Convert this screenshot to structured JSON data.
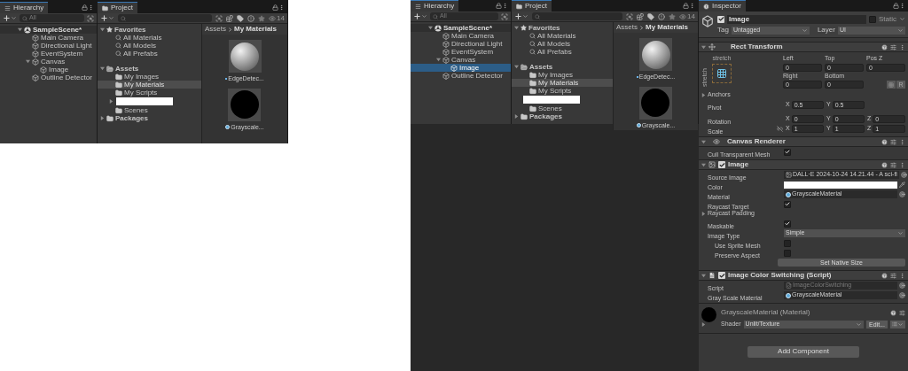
{
  "left_screenshot": {
    "hierarchy": {
      "tab": "Hierarchy",
      "search_placeholder": "All",
      "tree": [
        {
          "label": "SampleScene*",
          "kind": "scene",
          "selected": false,
          "expanded": true,
          "children": [
            {
              "label": "Main Camera",
              "kind": "object",
              "selected": false
            },
            {
              "label": "Directional Light",
              "kind": "object",
              "selected": false
            },
            {
              "label": "EventSystem",
              "kind": "object",
              "selected": false
            },
            {
              "label": "Canvas",
              "kind": "object",
              "selected": false,
              "expanded": true,
              "children": [
                {
                  "label": "Image",
                  "kind": "object",
                  "selected": false
                }
              ]
            },
            {
              "label": "Outline Detector",
              "kind": "object",
              "selected": false
            }
          ]
        }
      ]
    },
    "project": {
      "tab": "Project",
      "count": "14",
      "tree": [
        {
          "label": "Favorites",
          "kind": "favorites",
          "selected": false,
          "expanded": true,
          "children": [
            {
              "label": "All Materials",
              "kind": "search",
              "selected": false
            },
            {
              "label": "All Models",
              "kind": "search",
              "selected": false
            },
            {
              "label": "All Prefabs",
              "kind": "search",
              "selected": false
            }
          ]
        },
        {
          "label": "Assets",
          "kind": "folder",
          "selected": false,
          "expanded": true,
          "children": [
            {
              "label": "My Images",
              "kind": "folder",
              "selected": false
            },
            {
              "label": "My Materials",
              "kind": "folder",
              "selected": true
            },
            {
              "label": "My Scripts",
              "kind": "folder",
              "selected": false
            },
            {
              "kind": "redacted",
              "expanded": false
            },
            {
              "label": "Scenes",
              "kind": "folder",
              "selected": false
            }
          ]
        },
        {
          "label": "Packages",
          "kind": "folder",
          "selected": false,
          "expanded": false
        }
      ],
      "breadcrumb": [
        "Assets",
        "My Materials"
      ],
      "assets": [
        {
          "label": "EdgeDetec...",
          "kind": "sphere"
        },
        {
          "label": "Grayscale...",
          "kind": "black"
        }
      ]
    }
  },
  "right_window": {
    "hierarchy": {
      "tab": "Hierarchy",
      "search_placeholder": "All",
      "tree": [
        {
          "label": "SampleScene*",
          "kind": "scene",
          "selected": false,
          "expanded": true,
          "children": [
            {
              "label": "Main Camera",
              "kind": "object",
              "selected": false
            },
            {
              "label": "Directional Light",
              "kind": "object",
              "selected": false
            },
            {
              "label": "EventSystem",
              "kind": "object",
              "selected": false
            },
            {
              "label": "Canvas",
              "kind": "object",
              "selected": false,
              "expanded": true,
              "children": [
                {
                  "label": "Image",
                  "kind": "object",
                  "selected": true
                }
              ]
            },
            {
              "label": "Outline Detector",
              "kind": "object",
              "selected": false
            }
          ]
        }
      ]
    },
    "project": {
      "tab": "Project",
      "count": "14",
      "tree": [
        {
          "label": "Favorites",
          "kind": "favorites",
          "selected": false,
          "expanded": true,
          "children": [
            {
              "label": "All Materials",
              "kind": "search",
              "selected": false
            },
            {
              "label": "All Models",
              "kind": "search",
              "selected": false
            },
            {
              "label": "All Prefabs",
              "kind": "search",
              "selected": false
            }
          ]
        },
        {
          "label": "Assets",
          "kind": "folder",
          "selected": false,
          "expanded": true,
          "children": [
            {
              "label": "My Images",
              "kind": "folder",
              "selected": false
            },
            {
              "label": "My Materials",
              "kind": "folder",
              "selected": true
            },
            {
              "label": "My Scripts",
              "kind": "folder",
              "selected": false
            },
            {
              "kind": "redacted"
            },
            {
              "label": "Scenes",
              "kind": "folder",
              "selected": false
            }
          ]
        },
        {
          "label": "Packages",
          "kind": "folder",
          "selected": false,
          "expanded": false
        }
      ],
      "breadcrumb": [
        "Assets",
        "My Materials"
      ],
      "assets": [
        {
          "label": "EdgeDetec...",
          "kind": "sphere"
        },
        {
          "label": "Grayscale...",
          "kind": "black"
        }
      ]
    },
    "inspector": {
      "tab": "Inspector",
      "active": true,
      "name": "Image",
      "static_label": "Static",
      "static": false,
      "tag_label": "Tag",
      "tag": "Untagged",
      "layer_label": "Layer",
      "layer": "UI",
      "rect_transform": {
        "title": "Rect Transform",
        "expanded": true,
        "anchor_labels": [
          "stretch",
          "stretch"
        ],
        "offsets": [
          {
            "label": "Left",
            "value": "0"
          },
          {
            "label": "Top",
            "value": "0"
          },
          {
            "label": "Pos Z",
            "value": "0"
          },
          {
            "label": "Right",
            "value": "0"
          },
          {
            "label": "Bottom",
            "value": "0"
          }
        ],
        "raw_button": "R",
        "anchors": {
          "label": "Anchors",
          "expanded": false
        },
        "vectors": [
          {
            "label": "Pivot",
            "kind": "pivot",
            "axes": [
              {
                "axis": "X",
                "value": "0.5"
              },
              {
                "axis": "Y",
                "value": "0.5"
              }
            ]
          },
          {
            "label": "Rotation",
            "kind": "plain",
            "axes": [
              {
                "axis": "X",
                "value": "0"
              },
              {
                "axis": "Y",
                "value": "0"
              },
              {
                "axis": "Z",
                "value": "0"
              }
            ]
          },
          {
            "label": "Scale",
            "kind": "scale",
            "axes": [
              {
                "axis": "X",
                "value": "1"
              },
              {
                "axis": "Y",
                "value": "1"
              },
              {
                "axis": "Z",
                "value": "1"
              }
            ]
          }
        ]
      },
      "components": [
        {
          "title": "Canvas Renderer",
          "kind": "canvas_renderer",
          "expanded": true,
          "rows": [
            {
              "kind": "checkbox",
              "label": "Cull Transparent Mesh",
              "checked": true
            }
          ]
        },
        {
          "title": "Image",
          "kind": "image",
          "enabled": true,
          "expanded": true,
          "rows": [
            {
              "kind": "sprite_field",
              "label": "Source Image",
              "value": "DALL·E 2024-10-24 14.21.44 - A sci-fi"
            },
            {
              "kind": "color",
              "label": "Color",
              "color": "#ffffff"
            },
            {
              "kind": "material_field",
              "label": "Material",
              "value": "GrayscaleMaterial"
            },
            {
              "kind": "checkbox",
              "label": "Raycast Target",
              "checked": true
            },
            {
              "kind": "foldout",
              "label": "Raycast Padding",
              "expanded": false
            },
            {
              "kind": "checkbox",
              "label": "Maskable",
              "checked": true
            },
            {
              "kind": "dropdown",
              "label": "Image Type",
              "value": "Simple"
            },
            {
              "kind": "checkbox",
              "label": "Use Sprite Mesh",
              "checked": false,
              "indented": true
            },
            {
              "kind": "checkbox",
              "label": "Preserve Aspect",
              "checked": false,
              "indented": true
            },
            {
              "kind": "button",
              "label": "Set Native Size"
            }
          ]
        },
        {
          "title": "Image Color Switching (Script)",
          "kind": "script",
          "enabled": true,
          "expanded": true,
          "rows": [
            {
              "kind": "script_field",
              "label": "Script",
              "value": "ImageColorSwitching",
              "disabled": true
            },
            {
              "kind": "material_field",
              "label": "Gray Scale Material",
              "value": "GrayscaleMaterial"
            }
          ]
        }
      ],
      "material": {
        "title": "GrayscaleMaterial (Material)",
        "shader_label": "Shader",
        "shader": "Unlit/Texture",
        "edit_button": "Edit...",
        "expanded": false
      },
      "add_component": "Add Component"
    }
  }
}
